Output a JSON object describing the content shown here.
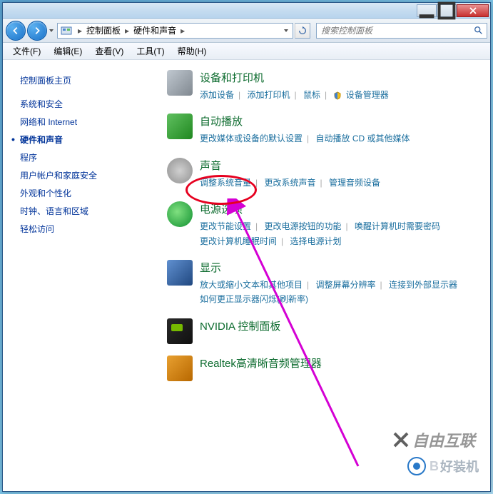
{
  "navbar": {
    "breadcrumb": [
      "控制面板",
      "硬件和声音"
    ],
    "search_placeholder": "搜索控制面板"
  },
  "menubar": {
    "items": [
      "文件(F)",
      "编辑(E)",
      "查看(V)",
      "工具(T)",
      "帮助(H)"
    ]
  },
  "sidebar": {
    "title": "控制面板主页",
    "items": [
      {
        "label": "系统和安全",
        "active": false
      },
      {
        "label": "网络和 Internet",
        "active": false
      },
      {
        "label": "硬件和声音",
        "active": true
      },
      {
        "label": "程序",
        "active": false
      },
      {
        "label": "用户帐户和家庭安全",
        "active": false
      },
      {
        "label": "外观和个性化",
        "active": false
      },
      {
        "label": "时钟、语言和区域",
        "active": false
      },
      {
        "label": "轻松访问",
        "active": false
      }
    ]
  },
  "categories": [
    {
      "title": "设备和打印机",
      "links": [
        "添加设备",
        "添加打印机",
        "鼠标"
      ],
      "shield_link": "设备管理器"
    },
    {
      "title": "自动播放",
      "links": [
        "更改媒体或设备的默认设置",
        "自动播放 CD 或其他媒体"
      ]
    },
    {
      "title": "声音",
      "links": [
        "调整系统音量",
        "更改系统声音",
        "管理音频设备"
      ]
    },
    {
      "title": "电源选项",
      "links": [
        "更改节能设置",
        "更改电源按钮的功能",
        "唤醒计算机时需要密码",
        "更改计算机睡眠时间",
        "选择电源计划"
      ]
    },
    {
      "title": "显示",
      "links": [
        "放大或缩小文本和其他项目",
        "调整屏幕分辨率",
        "连接到外部显示器",
        "如何更正显示器闪烁(刷新率)"
      ]
    },
    {
      "title": "NVIDIA 控制面板",
      "links": []
    },
    {
      "title": "Realtek高清晰音频管理器",
      "links": []
    }
  ],
  "watermarks": {
    "wm1": "自由互联",
    "wm2_prefix": "B",
    "wm2_text": "好装机"
  }
}
